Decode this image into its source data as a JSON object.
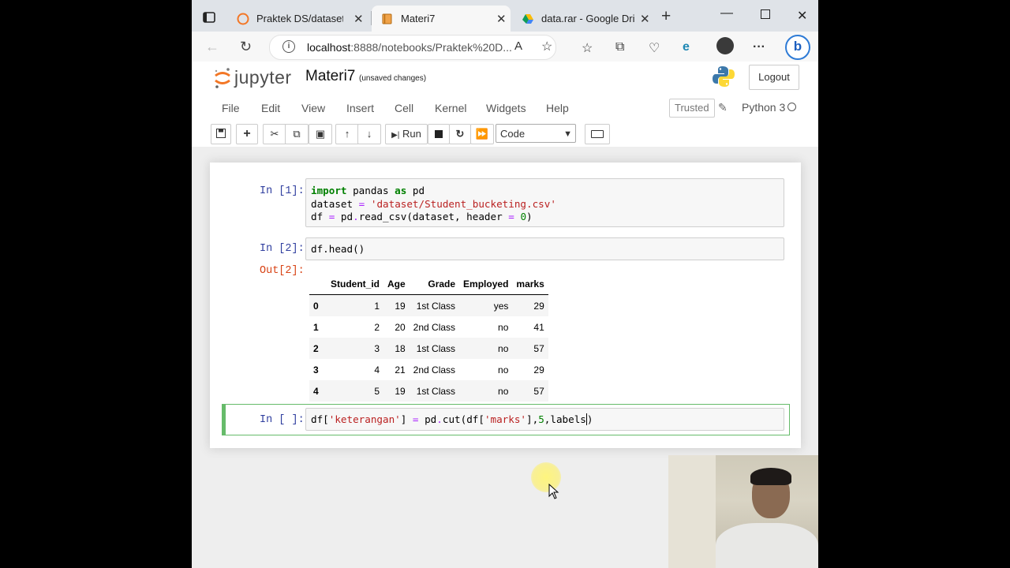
{
  "browser": {
    "tabs": [
      {
        "label": "Praktek DS/dataset/",
        "icon": "jupyter-icon",
        "active": false
      },
      {
        "label": "Materi7",
        "icon": "notebook-icon",
        "active": true
      },
      {
        "label": "data.rar - Google Drive",
        "icon": "google-drive-icon",
        "active": false
      }
    ],
    "url_host": "localhost",
    "url_path": ":8888/notebooks/Praktek%20D...",
    "close_glyph": "✕",
    "newtab_glyph": "+",
    "more_glyph": "···",
    "bing_label": "b"
  },
  "jupyter": {
    "logo_text": "jupyter",
    "notebook_title": "Materi7",
    "save_status": "(unsaved changes)",
    "logout_label": "Logout",
    "menu": [
      "File",
      "Edit",
      "View",
      "Insert",
      "Cell",
      "Kernel",
      "Widgets",
      "Help"
    ],
    "trusted_label": "Trusted",
    "kernel_name": "Python 3",
    "run_label": "Run",
    "cell_type": "Code"
  },
  "cells": [
    {
      "prompt": "In [1]:",
      "lines": [
        "import pandas as pd",
        "dataset = 'dataset/Student_bucketing.csv'",
        "df = pd.read_csv(dataset, header = 0)"
      ]
    },
    {
      "prompt": "In [2]:",
      "lines": [
        "df.head()"
      ],
      "out_prompt": "Out[2]:"
    },
    {
      "prompt": "In [ ]:",
      "lines": [
        "df['keterangan'] = pd.cut(df['marks'],5,labels)"
      ]
    }
  ],
  "dataframe": {
    "columns": [
      "Student_id",
      "Age",
      "Grade",
      "Employed",
      "marks"
    ],
    "rows": [
      {
        "index": "0",
        "values": [
          "1",
          "19",
          "1st Class",
          "yes",
          "29"
        ]
      },
      {
        "index": "1",
        "values": [
          "2",
          "20",
          "2nd Class",
          "no",
          "41"
        ]
      },
      {
        "index": "2",
        "values": [
          "3",
          "18",
          "1st Class",
          "no",
          "57"
        ]
      },
      {
        "index": "3",
        "values": [
          "4",
          "21",
          "2nd Class",
          "no",
          "29"
        ]
      },
      {
        "index": "4",
        "values": [
          "5",
          "19",
          "1st Class",
          "no",
          "57"
        ]
      }
    ]
  },
  "colors": {
    "prompt_in": "#303f9f",
    "prompt_out": "#d84315",
    "selected_cell": "#66bb6a"
  }
}
